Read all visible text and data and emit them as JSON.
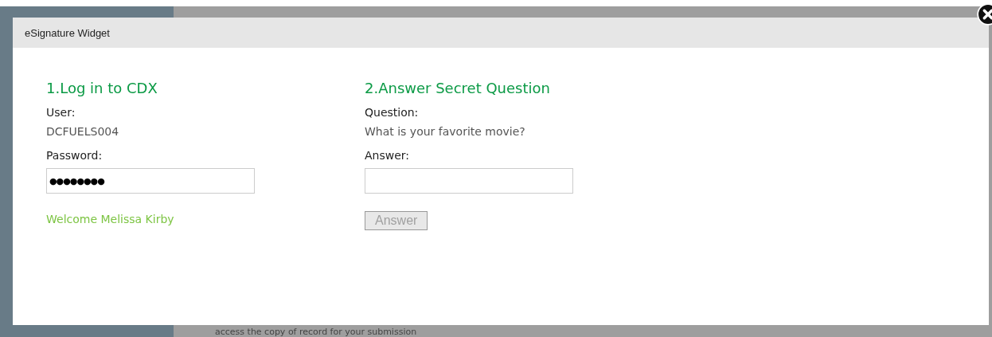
{
  "background": {
    "text": "access the copy of record for your submission"
  },
  "dialog": {
    "title": "eSignature Widget",
    "login": {
      "heading": "1.Log in to CDX",
      "user_label": "User:",
      "user": "DCFUELS004",
      "password_label": "Password:",
      "password_mask": "●●●●●●●●",
      "welcome": "Welcome Melissa Kirby"
    },
    "question": {
      "heading": "2.Answer Secret Question",
      "question_label": "Question:",
      "question": "What is your favorite movie?",
      "answer_label": "Answer:",
      "button": {
        "label": "Answer",
        "disabled": true
      }
    }
  }
}
